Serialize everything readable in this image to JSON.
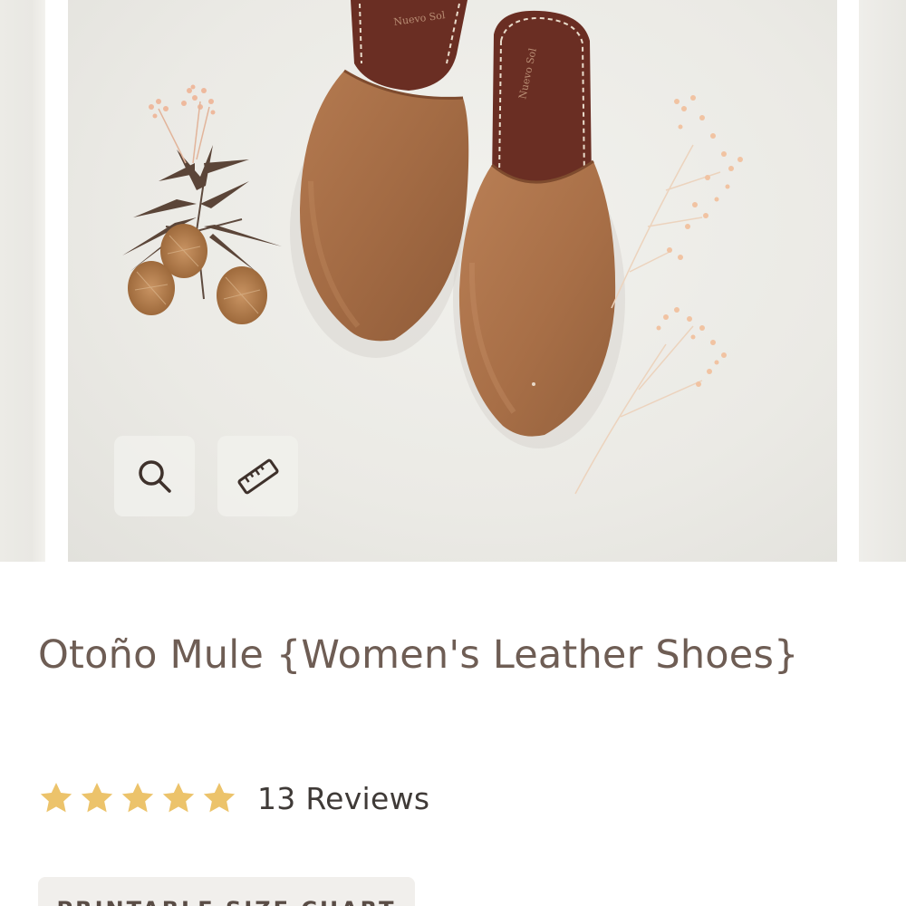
{
  "product": {
    "title": "Otoño Mule {Women's Leather Shoes}",
    "rating": {
      "stars": 5,
      "max_stars": 5,
      "reviews_label": "13 Reviews"
    },
    "size_chart_label": "PRINTABLE SIZE CHART"
  },
  "gallery": {
    "image_subject": "brown leather mule shoes with dried flowers",
    "controls": {
      "zoom_icon": "search-icon",
      "measure_icon": "ruler-icon"
    }
  },
  "colors": {
    "title": "#6e5d54",
    "star": "#ecc36b",
    "leather": "#a66e47",
    "button_bg": "#f1efec"
  }
}
